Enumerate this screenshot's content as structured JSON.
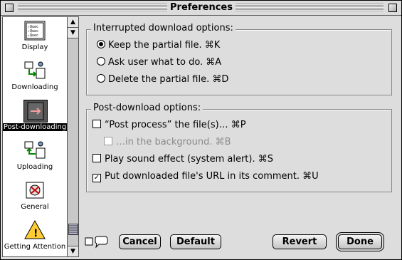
{
  "window": {
    "title": "Preferences"
  },
  "sidebar": {
    "items": [
      {
        "label": "Display",
        "icon": "display-icon"
      },
      {
        "label": "Downloading",
        "icon": "downloading-icon"
      },
      {
        "label": "Post-downloading",
        "icon": "post-downloading-icon",
        "selected": true
      },
      {
        "label": "Uploading",
        "icon": "uploading-icon"
      },
      {
        "label": "General",
        "icon": "general-icon"
      },
      {
        "label": "Getting Attention",
        "icon": "getting-attention-icon"
      }
    ]
  },
  "interrupted": {
    "title": "Interrupted download options:",
    "options": [
      {
        "label": "Keep the partial file. ⌘K",
        "checked": true
      },
      {
        "label": "Ask user what to do. ⌘A",
        "checked": false
      },
      {
        "label": "Delete the partial file. ⌘D",
        "checked": false
      }
    ]
  },
  "post": {
    "title": "Post-download options:",
    "options": [
      {
        "label": "“Post process” the file(s)… ⌘P",
        "checked": false
      },
      {
        "label": "…in the background. ⌘B",
        "checked": false,
        "disabled": true
      },
      {
        "label": "Play sound effect (system alert). ⌘S",
        "checked": false
      },
      {
        "label": "Put downloaded file's URL in its comment. ⌘U",
        "checked": true
      }
    ]
  },
  "buttons": {
    "cancel": "Cancel",
    "default": "Default",
    "revert": "Revert",
    "done": "Done"
  }
}
